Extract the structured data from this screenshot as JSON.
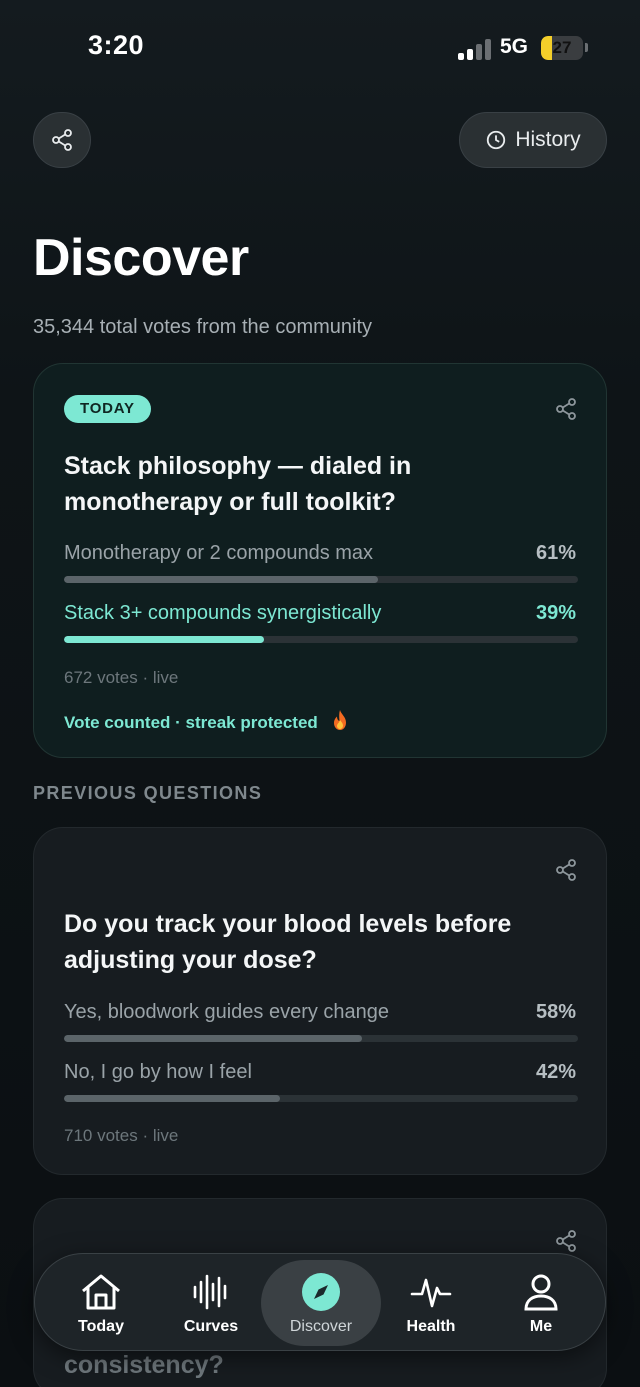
{
  "status_bar": {
    "time": "3:20",
    "network": "5G",
    "battery": "27",
    "battery_level_pct": 27
  },
  "header": {
    "history_label": "History"
  },
  "page": {
    "title": "Discover",
    "subtitle": "35,344 total votes from the community"
  },
  "today": {
    "badge": "TODAY",
    "question": "Stack philosophy — dialed in monotherapy or full toolkit?",
    "options": [
      {
        "label": "Monotherapy or 2 compounds max",
        "percent": "61%",
        "value": 61
      },
      {
        "label": "Stack 3+ compounds synergistically",
        "percent": "39%",
        "value": 39
      }
    ],
    "votes": "672 votes · live",
    "counted": "Vote counted · streak protected"
  },
  "previous": {
    "section_label": "PREVIOUS QUESTIONS",
    "items": [
      {
        "question": "Do you track your blood levels before adjusting your dose?",
        "options": [
          {
            "label": "Yes, bloodwork guides every change",
            "percent": "58%",
            "value": 58
          },
          {
            "label": "No, I go by how I feel",
            "percent": "42%",
            "value": 42
          }
        ],
        "votes": "710 votes · live"
      }
    ],
    "partial_question_visible": "consistency?"
  },
  "tabs": [
    {
      "label": "Today",
      "icon": "home-icon"
    },
    {
      "label": "Curves",
      "icon": "waveform-icon"
    },
    {
      "label": "Discover",
      "icon": "compass-icon",
      "active": true
    },
    {
      "label": "Health",
      "icon": "pulse-icon"
    },
    {
      "label": "Me",
      "icon": "person-icon"
    }
  ],
  "colors": {
    "accent": "#7de8d3",
    "background": "#0c1114",
    "card": "#171c20"
  }
}
